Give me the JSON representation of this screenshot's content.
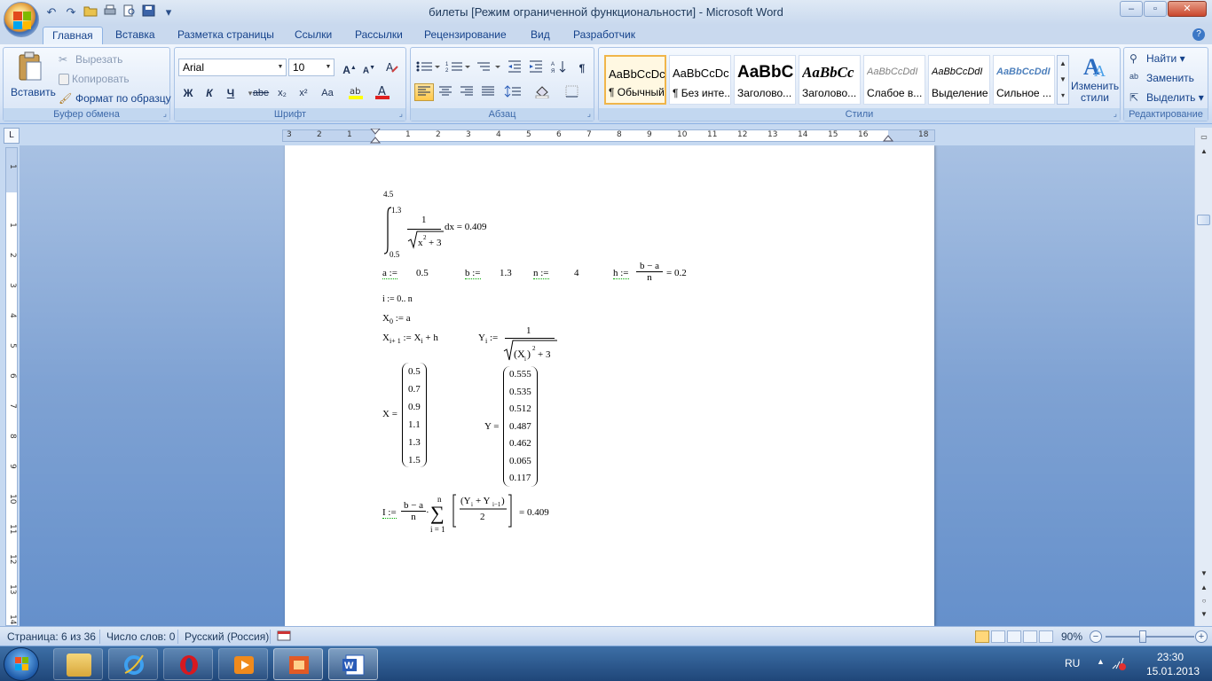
{
  "window": {
    "title": "билеты [Режим ограниченной функциональности] - Microsoft Word",
    "controls": {
      "minimize": "–",
      "maximize": "▫",
      "close": "✕"
    }
  },
  "qat": {
    "undo": "↶",
    "redo": "↷",
    "more": "▾"
  },
  "tabs": [
    "Главная",
    "Вставка",
    "Разметка страницы",
    "Ссылки",
    "Рассылки",
    "Рецензирование",
    "Вид",
    "Разработчик"
  ],
  "ribbon": {
    "clipboard": {
      "label": "Буфер обмена",
      "paste": "Вставить",
      "cut": "Вырезать",
      "copy": "Копировать",
      "format_painter": "Формат по образцу"
    },
    "font": {
      "label": "Шрифт",
      "font_name": "Arial",
      "font_size": "10",
      "bold": "Ж",
      "italic": "К",
      "underline": "Ч",
      "strike": "abe",
      "subscript": "x₂",
      "superscript": "x²",
      "change_case": "Aa"
    },
    "paragraph": {
      "label": "Абзац",
      "pilcrow": "¶"
    },
    "styles": {
      "label": "Стили",
      "items": [
        {
          "sample": "AaBbCcDc",
          "name": "¶ Обычный"
        },
        {
          "sample": "AaBbCcDc",
          "name": "¶ Без инте..."
        },
        {
          "sample": "AaBbC",
          "name": "Заголово..."
        },
        {
          "sample": "AaBbCc",
          "name": "Заголово..."
        },
        {
          "sample": "AaBbCcDdI",
          "name": "Слабое в..."
        },
        {
          "sample": "AaBbCcDdI",
          "name": "Выделение"
        },
        {
          "sample": "AaBbCcDdI",
          "name": "Сильное ..."
        }
      ],
      "change_styles": "Изменить стили"
    },
    "editing": {
      "label": "Редактирование",
      "find": "Найти",
      "replace": "Заменить",
      "select": "Выделить"
    }
  },
  "ruler": {
    "corner": "L",
    "h_ticks": [
      "3",
      "2",
      "1",
      "1",
      "2",
      "3",
      "4",
      "5",
      "6",
      "7",
      "8",
      "9",
      "10",
      "11",
      "12",
      "13",
      "14",
      "15",
      "16",
      "18"
    ],
    "v_ticks": [
      "1",
      "1",
      "2",
      "3",
      "4",
      "5",
      "6",
      "7",
      "8",
      "9",
      "10",
      "11",
      "12",
      "13",
      "14"
    ]
  },
  "doc": {
    "upper_limit": "4.5",
    "int_upper": "1.3",
    "int_lower": "0.5",
    "int_num": "1",
    "int_rest": "dx = 0.409",
    "a_def": "a :=",
    "a_val": "0.5",
    "b_def": "b :=",
    "b_val": "1.3",
    "n_def": "n :=",
    "n_val": "4",
    "h_def": "h :=",
    "h_num": "b − a",
    "h_den": "n",
    "h_val": "= 0.2",
    "i_range": "i := 0.. n",
    "x0": "X",
    "x0_rest": ":= a",
    "xi_rest": ":= X",
    "xi_tail": "+ h",
    "yi_num": "1",
    "x_label": "X =",
    "x_values": [
      "0.5",
      "0.7",
      "0.9",
      "1.1",
      "1.3",
      "1.5"
    ],
    "y_label": "Y =",
    "y_values": [
      "0.555",
      "0.535",
      "0.512",
      "0.487",
      "0.462",
      "0.065",
      "0.117"
    ],
    "i_lhs": "I :=",
    "i_frac_num": "b − a",
    "i_frac_den": "n",
    "sum_upper": "n",
    "sum_lower": "i = 1",
    "i_result": "= 0.409"
  },
  "status": {
    "page": "Страница: 6 из 36",
    "words": "Число слов: 0",
    "language": "Русский (Россия)",
    "zoom": "90%"
  },
  "taskbar": {
    "lang": "RU",
    "time": "23:30",
    "date": "15.01.2013"
  }
}
